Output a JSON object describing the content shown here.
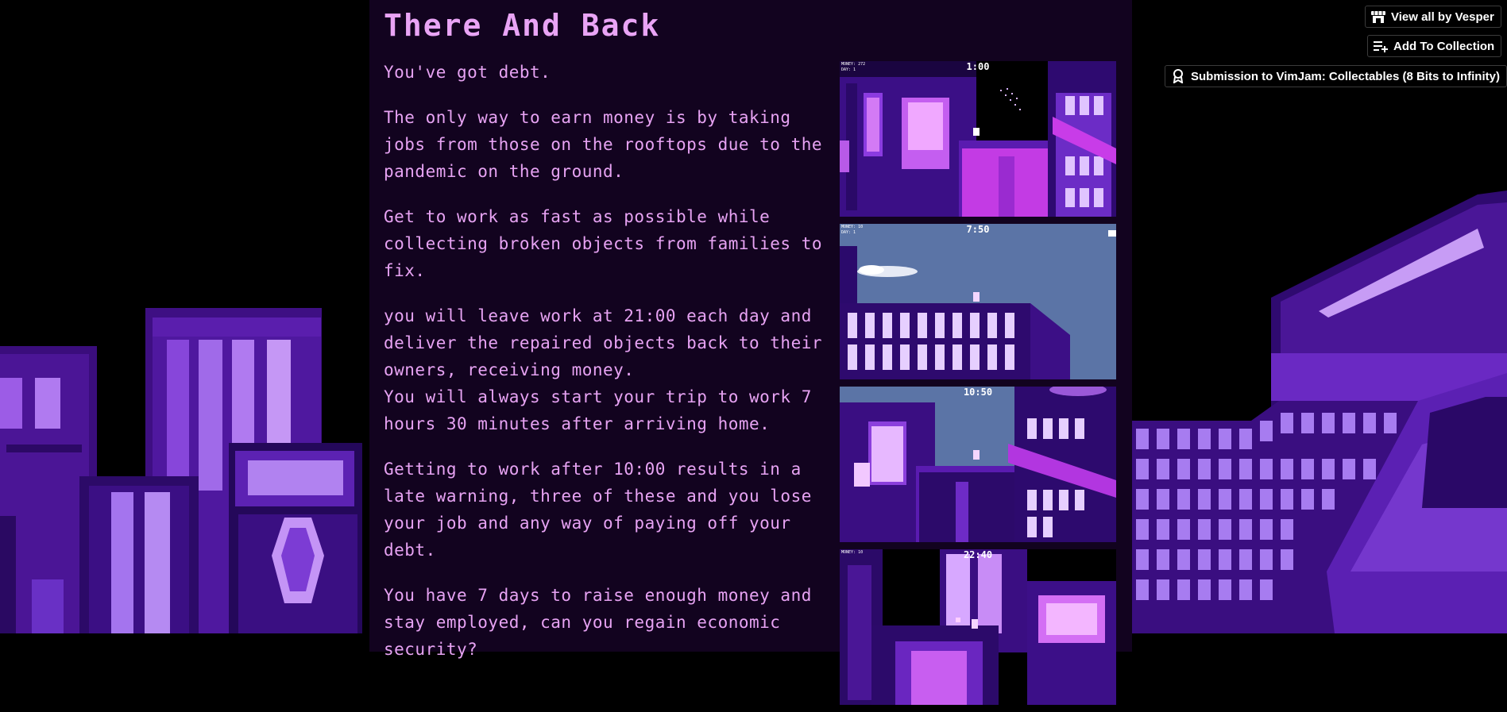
{
  "game": {
    "title": "There And Back",
    "paragraphs": [
      "You've got debt.",
      "The only way to earn money is by taking jobs from those on the rooftops due to the pandemic on the ground.",
      "Get to work as fast as possible while collecting broken objects from families to fix.",
      "you will leave work at 21:00 each day and deliver the repaired objects back to their owners, receiving money.",
      "You will always start your trip to work 7 hours 30 minutes after arriving home.",
      "Getting to work after 10:00 results in a late warning, three of these and you lose your job and any way of paying off your debt.",
      "You have 7 days to raise enough money and stay employed, can you regain economic security?"
    ]
  },
  "screenshots": [
    {
      "time": "1:00",
      "hud": [
        "MONEY: 272",
        "DAY: 1"
      ]
    },
    {
      "time": "7:50",
      "hud": [
        "MONEY: 10",
        "DAY: 1"
      ]
    },
    {
      "time": "10:50",
      "hud": []
    },
    {
      "time": "22:40",
      "hud": [
        "MONEY: 10"
      ]
    }
  ],
  "actions": {
    "view_all": "View all by Vesper",
    "add_collection": "Add To Collection",
    "submission": "Submission to VimJam: Collectables (8 Bits to Infinity)"
  },
  "icons": {
    "view_all": "storefront-icon",
    "add_collection": "playlist-add-icon",
    "submission": "award-ribbon-icon"
  },
  "colors": {
    "page_bg": "#12031f",
    "text": "#e7a3f3",
    "purple_light": "#c67bf2",
    "purple_mid": "#7a2fd1",
    "purple_dark": "#3a0c7a"
  }
}
